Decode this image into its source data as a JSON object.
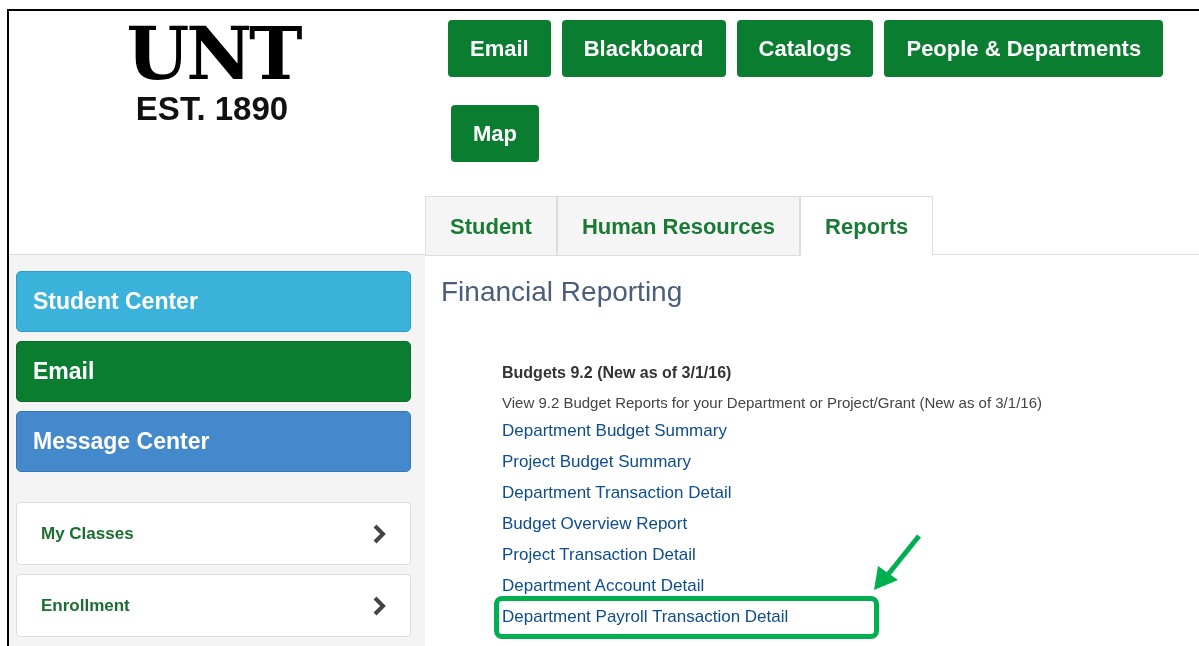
{
  "logo": {
    "name": "UNT",
    "tagline": "EST. 1890"
  },
  "quick_links": [
    {
      "label": "Email"
    },
    {
      "label": "Blackboard"
    },
    {
      "label": "Catalogs"
    },
    {
      "label": "People & Departments"
    },
    {
      "label": "Map"
    }
  ],
  "tabs": [
    {
      "label": "Student",
      "selected": false
    },
    {
      "label": "Human Resources",
      "selected": false
    },
    {
      "label": "Reports",
      "selected": true
    }
  ],
  "sidebar": {
    "tiles": [
      {
        "label": "Student Center",
        "kind": "cyan"
      },
      {
        "label": "Email",
        "kind": "green"
      },
      {
        "label": "Message Center",
        "kind": "blue"
      }
    ],
    "cards": [
      {
        "label": "My Classes"
      },
      {
        "label": "Enrollment"
      }
    ]
  },
  "content": {
    "title": "Financial Reporting",
    "section": {
      "heading": "Budgets 9.2 (New as of 3/1/16)",
      "description": "View 9.2 Budget Reports for your Department or Project/Grant (New as of 3/1/16)",
      "links": [
        {
          "label": "Department Budget Summary",
          "highlighted": false
        },
        {
          "label": "Project Budget Summary",
          "highlighted": false
        },
        {
          "label": "Department Transaction Detail",
          "highlighted": false
        },
        {
          "label": "Budget Overview Report",
          "highlighted": false
        },
        {
          "label": "Project Transaction Detail",
          "highlighted": false
        },
        {
          "label": "Department Account Detail",
          "highlighted": false
        },
        {
          "label": "Department Payroll Transaction Detail",
          "highlighted": true
        }
      ]
    }
  }
}
